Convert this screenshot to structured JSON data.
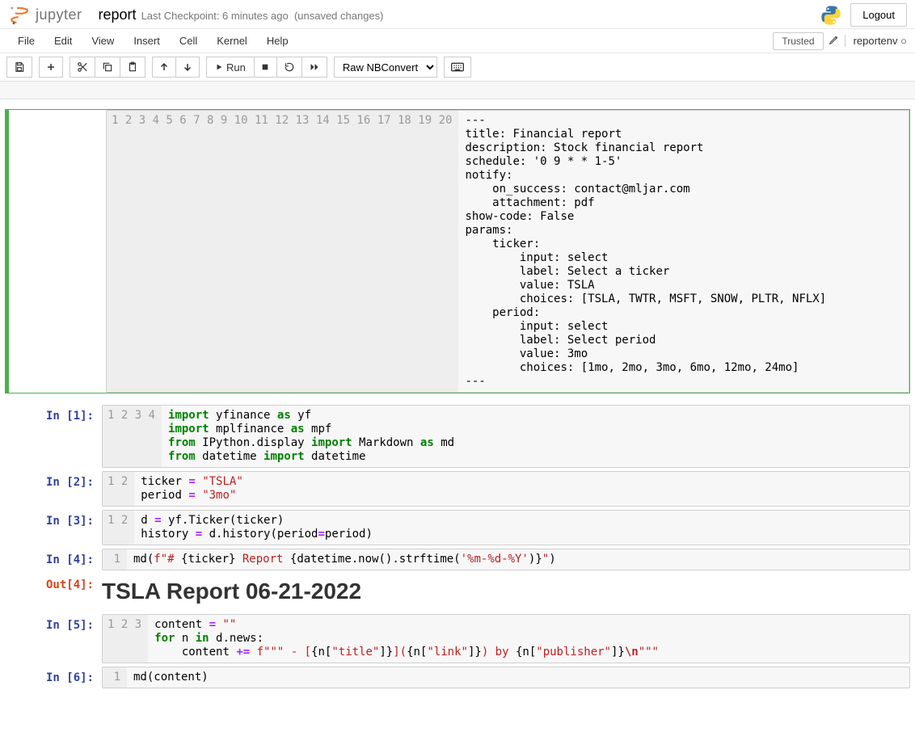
{
  "header": {
    "logo_text": "jupyter",
    "notebook_name": "report",
    "checkpoint_prefix": "Last Checkpoint:",
    "checkpoint_time": "6 minutes ago",
    "unsaved": "(unsaved changes)",
    "kernel_indicator_title": "Python 3",
    "logout": "Logout"
  },
  "menubar": {
    "items": [
      "File",
      "Edit",
      "View",
      "Insert",
      "Cell",
      "Kernel",
      "Help"
    ],
    "trusted": "Trusted",
    "kernel_display_name": "reportenv",
    "kernel_busy_suffix": "○"
  },
  "toolbar": {
    "run_label": "Run",
    "celltype_selected": "Raw NBConvert"
  },
  "cells": [
    {
      "type": "raw",
      "prompt": "",
      "line_count": 20,
      "source": "---\ntitle: Financial report\ndescription: Stock financial report\nschedule: '0 9 * * 1-5'\nnotify:\n    on_success: contact@mljar.com\n    attachment: pdf\nshow-code: False\nparams:\n    ticker:\n        input: select\n        label: Select a ticker\n        value: TSLA\n        choices: [TSLA, TWTR, MSFT, SNOW, PLTR, NFLX]\n    period:\n        input: select\n        label: Select period\n        value: 3mo\n        choices: [1mo, 2mo, 3mo, 6mo, 12mo, 24mo]\n---"
    },
    {
      "type": "code",
      "prompt": "In [1]:",
      "line_count": 4,
      "html": "<span class=\"k\">import</span> yfinance <span class=\"k\">as</span> yf\n<span class=\"k\">import</span> mplfinance <span class=\"k\">as</span> mpf\n<span class=\"k\">from</span> IPython.display <span class=\"k\">import</span> Markdown <span class=\"k\">as</span> md\n<span class=\"k\">from</span> datetime <span class=\"k\">import</span> datetime"
    },
    {
      "type": "code",
      "prompt": "In [2]:",
      "line_count": 2,
      "html": "ticker <span class=\"op\">=</span> <span class=\"s\">\"TSLA\"</span>\nperiod <span class=\"op\">=</span> <span class=\"s\">\"3mo\"</span>"
    },
    {
      "type": "code",
      "prompt": "In [3]:",
      "line_count": 2,
      "html": "d <span class=\"op\">=</span> yf.Ticker(ticker)\nhistory <span class=\"op\">=</span> d.history(period<span class=\"op\">=</span>period)"
    },
    {
      "type": "code",
      "prompt": "In [4]:",
      "line_count": 1,
      "html": "md(<span class=\"s\">f\"# </span>{ticker}<span class=\"s\"> Report </span>{datetime.now().strftime(<span class=\"s\">'%m-%d-%Y'</span>)}<span class=\"s\">\"</span>)"
    },
    {
      "type": "output",
      "prompt": "Out[4]:",
      "markdown_h1": "TSLA Report 06-21-2022"
    },
    {
      "type": "code",
      "prompt": "In [5]:",
      "line_count": 3,
      "html": "content <span class=\"op\">=</span> <span class=\"s\">\"\"</span>\n<span class=\"k\">for</span> n <span class=\"k\">in</span> d.news:\n    content <span class=\"op\">+=</span> <span class=\"s\">f\"\"\" - [</span>{n[<span class=\"s\">\"title\"</span>]}<span class=\"s\">](</span>{n[<span class=\"s\">\"link\"</span>]}<span class=\"s\">) by </span>{n[<span class=\"s\">\"publisher\"</span>]}<span class=\"se\">\\n</span><span class=\"s\">\"\"\"</span>"
    },
    {
      "type": "code",
      "prompt": "In [6]:",
      "line_count": 1,
      "html": "md(content)"
    }
  ]
}
